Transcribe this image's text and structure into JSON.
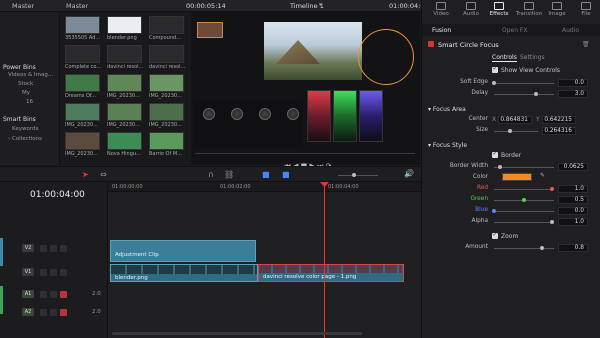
{
  "header": {
    "master": "Master",
    "timecode_left": "00:00:05:14",
    "timeline_name": "Timeline 1",
    "timecode_right": "01:00:04:00",
    "inspector_tabs": [
      "Video",
      "Audio",
      "Effects",
      "Transition",
      "Image",
      "File"
    ]
  },
  "bins": {
    "master": "Master",
    "power_bins": "Power Bins",
    "power_items": [
      "Videos & Imag...",
      "Stock",
      "My",
      "16"
    ],
    "smart_bins": "Smart Bins",
    "smart_items": [
      "Keywords",
      "Collections"
    ]
  },
  "media": {
    "clips": [
      {
        "label": "3535505 Ad...",
        "color": "#7c8a9a"
      },
      {
        "label": "blender.png",
        "color": "#e9eef2"
      },
      {
        "label": "Compound...",
        "color": "#2a2a2e"
      },
      {
        "label": "Complete co...",
        "color": "#2a2a2e"
      },
      {
        "label": "davinci resol...",
        "color": "#2a2a2e"
      },
      {
        "label": "davinci resol...",
        "color": "#2a2a2e"
      },
      {
        "label": "Dreams Of...",
        "color": "#3f7a48"
      },
      {
        "label": "IMG_20230...",
        "color": "#5f8757"
      },
      {
        "label": "IMG_20230...",
        "color": "#6c9565"
      },
      {
        "label": "IMG_20230...",
        "color": "#4f7c5f"
      },
      {
        "label": "IMG_20230...",
        "color": "#5b7f55"
      },
      {
        "label": "IMG_20230...",
        "color": "#4d6e4b"
      },
      {
        "label": "IMG_20230...",
        "color": "#5c4a3e"
      },
      {
        "label": "Nova Hingu...",
        "color": "#3d8c54"
      },
      {
        "label": "Barrio Of M...",
        "color": "#5a9a5d"
      }
    ]
  },
  "inspector": {
    "subtabs": [
      "Fusion",
      "Open FX",
      "Audio"
    ],
    "effect_title": "Smart Circle Focus",
    "controls_tabs": [
      "Controls",
      "Settings"
    ],
    "show_view_controls": "Show View Controls",
    "soft_edge_label": "Soft Edge",
    "soft_edge": "0.0",
    "delay_label": "Delay",
    "delay": "3.0",
    "focus_area": "Focus Area",
    "center_label": "Center",
    "center_x_label": "X",
    "center_x": "0.864831",
    "center_y_label": "Y",
    "center_y": "0.642215",
    "size_label": "Size",
    "size": "0.264316",
    "focus_style": "Focus Style",
    "border_label": "Border",
    "border_width_label": "Border Width",
    "border_width": "0.0625",
    "color_label": "Color",
    "color_value": "#f58a1f",
    "red_label": "Red",
    "red": "1.0",
    "green_label": "Green",
    "green": "0.5",
    "blue_label": "Blue",
    "blue": "0.0",
    "alpha_label": "Alpha",
    "alpha": "1.0",
    "zoom_label": "Zoom",
    "amount_label": "Amount",
    "amount": "0.8"
  },
  "timeline": {
    "timecode": "01:00:04:00",
    "ruler": [
      "01:00:00:00",
      "01:00:02:00",
      "01:00:04:00"
    ],
    "tracks": [
      {
        "name": "V2",
        "type": "video"
      },
      {
        "name": "V1",
        "type": "video"
      },
      {
        "name": "A1",
        "type": "audio",
        "level": "2.0"
      },
      {
        "name": "A2",
        "type": "audio",
        "level": "2.0"
      }
    ],
    "clips": {
      "adjustment": "Adjustment Clip",
      "blender": "blender.png",
      "davinci": "davinci resolve color page - 1.png"
    }
  }
}
